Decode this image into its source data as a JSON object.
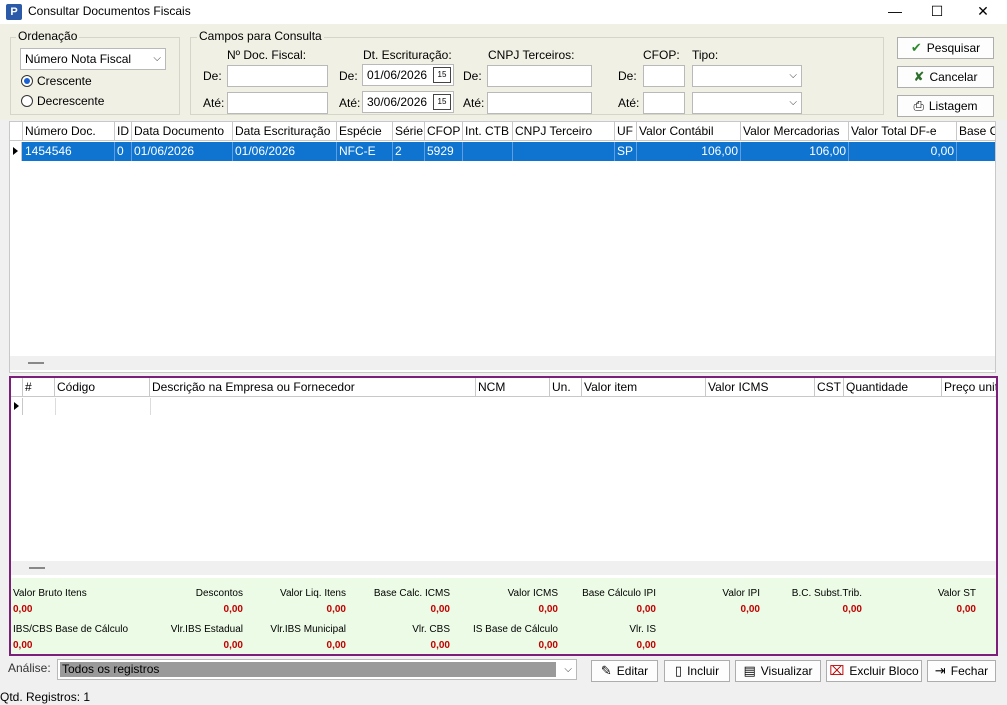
{
  "window": {
    "title": "Consultar Documentos Fiscais",
    "icon_letter": "P",
    "minimize": "—",
    "maximize": "☐",
    "close": "✕"
  },
  "ordenacao": {
    "title": "Ordenação",
    "selected": "Número Nota Fiscal",
    "options": [
      "Crescente",
      "Decrescente"
    ],
    "checked": "Crescente"
  },
  "campos": {
    "title": "Campos para Consulta",
    "nf_label": "Nº Doc. Fiscal:",
    "dt_label": "Dt. Escrituração:",
    "cnpj_label": "CNPJ Terceiros:",
    "cfop_label": "CFOP:",
    "tipo_label": "Tipo:",
    "de": "De:",
    "ate": "Até:",
    "dt_de": "01/06/2026",
    "dt_ate": "30/06/2026",
    "nf_de": "",
    "nf_ate": "",
    "cnpj_de": "",
    "cnpj_ate": "",
    "cfop_de": "",
    "cfop_ate": "",
    "tipo_de": "",
    "tipo_ate": ""
  },
  "buttons": {
    "pesquisar": "Pesquisar",
    "cancelar": "Cancelar",
    "listagem": "Listagem",
    "editar": "Editar",
    "incluir": "Incluir",
    "visualizar": "Visualizar",
    "excluir_bloco": "Excluir Bloco",
    "fechar": "Fechar"
  },
  "docs_grid": {
    "headers": [
      "Número Doc.",
      "ID",
      "Data Documento",
      "Data Escrituração",
      "Espécie",
      "Série",
      "CFOP",
      "Int. CTB",
      "CNPJ Terceiro",
      "UF",
      "Valor Contábil",
      "Valor Mercadorias",
      "Valor Total DF-e",
      "Base C"
    ],
    "rows": [
      [
        "1454546",
        "0",
        "01/06/2026",
        "01/06/2026",
        "NFC-E",
        "2",
        "5929",
        "",
        "",
        "SP",
        "106,00",
        "106,00",
        "0,00",
        ""
      ]
    ]
  },
  "items_grid": {
    "headers": [
      "#",
      "Código",
      "Descrição na Empresa ou Fornecedor",
      "NCM",
      "Un.",
      "Valor item",
      "Valor ICMS",
      "CST",
      "Quantidade",
      "Preço unit"
    ]
  },
  "totals": {
    "row1": [
      {
        "label": "Valor Bruto Itens",
        "value": "0,00"
      },
      {
        "label": "Descontos",
        "value": "0,00"
      },
      {
        "label": "Valor Liq. Itens",
        "value": "0,00"
      },
      {
        "label": "Base Calc. ICMS",
        "value": "0,00"
      },
      {
        "label": "Valor ICMS",
        "value": "0,00"
      },
      {
        "label": "Base Cálculo IPI",
        "value": "0,00"
      },
      {
        "label": "Valor IPI",
        "value": "0,00"
      },
      {
        "label": "B.C. Subst.Trib.",
        "value": "0,00"
      },
      {
        "label": "Valor ST",
        "value": "0,00"
      }
    ],
    "row2": [
      {
        "label": "IBS/CBS Base de Cálculo",
        "value": "0,00"
      },
      {
        "label": "Vlr.IBS Estadual",
        "value": "0,00"
      },
      {
        "label": "Vlr.IBS Municipal",
        "value": "0,00"
      },
      {
        "label": "Vlr. CBS",
        "value": "0,00"
      },
      {
        "label": "IS Base de Cálculo",
        "value": "0,00"
      },
      {
        "label": "Vlr. IS",
        "value": "0,00"
      }
    ]
  },
  "analise": {
    "label": "Análise:",
    "selected": "Todos os registros"
  },
  "status": {
    "text": "Qtd. Registros: 1"
  },
  "colors": {
    "selected_row": "#0f73d0",
    "items_border": "#7b1f7b",
    "totals_bg": "#ecfbe6",
    "totals_value": "#c00000"
  }
}
